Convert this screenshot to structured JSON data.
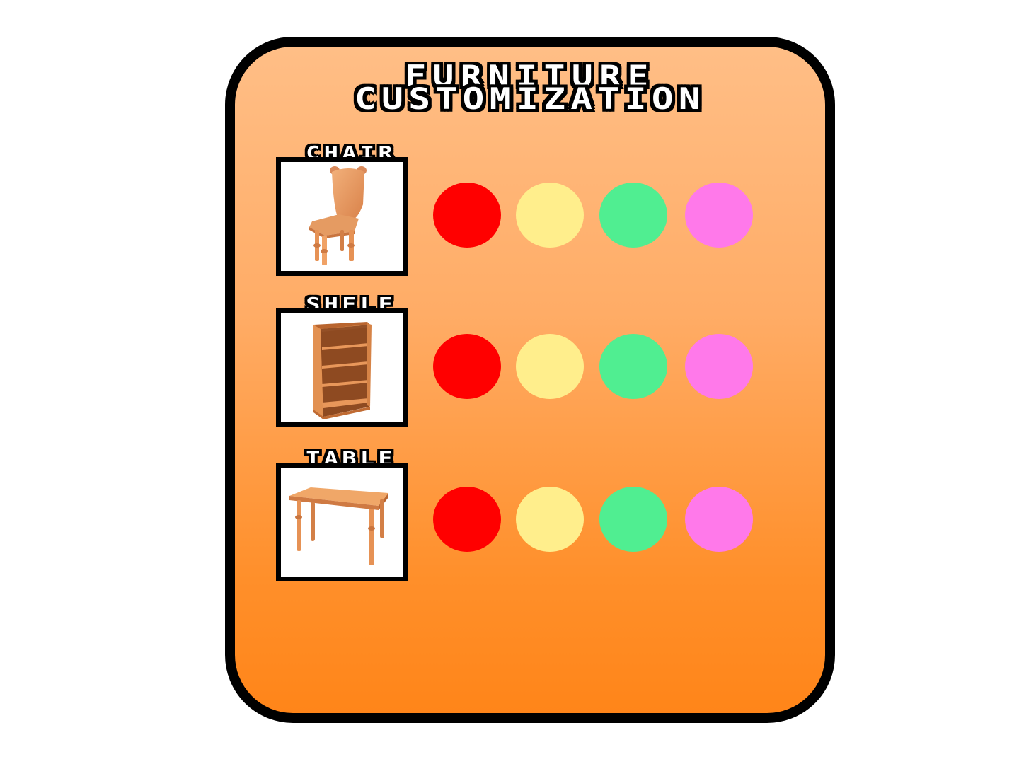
{
  "title": {
    "line1": "FURNITURE",
    "line2": "CUSTOMIZATION"
  },
  "colors": {
    "panel_border": "#000000",
    "panel_gradient_top": "#ffbe86",
    "panel_gradient_bottom": "#ff8519",
    "wood": "#e8955a"
  },
  "items": [
    {
      "label": "CHAIR",
      "icon": "chair-icon",
      "swatches": [
        {
          "name": "red",
          "color": "#ff0000"
        },
        {
          "name": "yellow",
          "color": "#ffee8c"
        },
        {
          "name": "green",
          "color": "#50ee91"
        },
        {
          "name": "pink",
          "color": "#ff79ea"
        }
      ]
    },
    {
      "label": "SHELF",
      "icon": "shelf-icon",
      "swatches": [
        {
          "name": "red",
          "color": "#ff0000"
        },
        {
          "name": "yellow",
          "color": "#ffee8c"
        },
        {
          "name": "green",
          "color": "#50ee91"
        },
        {
          "name": "pink",
          "color": "#ff79ea"
        }
      ]
    },
    {
      "label": "TABLE",
      "icon": "table-icon",
      "swatches": [
        {
          "name": "red",
          "color": "#ff0000"
        },
        {
          "name": "yellow",
          "color": "#ffee8c"
        },
        {
          "name": "green",
          "color": "#50ee91"
        },
        {
          "name": "pink",
          "color": "#ff79ea"
        }
      ]
    }
  ]
}
